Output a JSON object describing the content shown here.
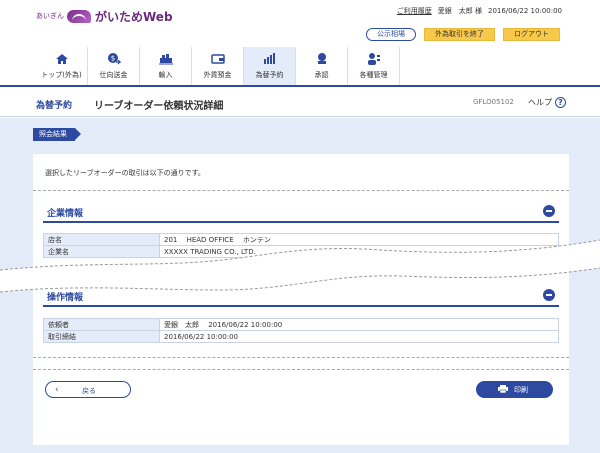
{
  "header": {
    "logo_prefix": "あいぎん",
    "logo_name": "がいためWeb",
    "history_link": "ご利用履歴",
    "user": "愛銀　太郎 様",
    "datetime": "2016/06/22 10:00:00",
    "rates_button": "公示相場",
    "end_button": "外為取引を終了",
    "logout_button": "ログアウト"
  },
  "nav": {
    "items": [
      {
        "label": "トップ(外為)",
        "icon": "home-icon"
      },
      {
        "label": "仕向送金",
        "icon": "remittance-icon"
      },
      {
        "label": "輸入",
        "icon": "import-icon"
      },
      {
        "label": "外貨預金",
        "icon": "deposit-icon"
      },
      {
        "label": "為替予約",
        "icon": "forex-contract-icon"
      },
      {
        "label": "承認",
        "icon": "approval-icon"
      },
      {
        "label": "各種管理",
        "icon": "management-icon"
      }
    ]
  },
  "titlebar": {
    "section": "為替予約",
    "title": "リーブオーダー依頼状況詳細",
    "code": "GFLO05102",
    "help": "ヘルプ"
  },
  "main": {
    "crumb": "照会結果",
    "intro": "選択したリーブオーダーの取引は以下の通りです。",
    "company_section": {
      "title": "企業情報",
      "rows": [
        {
          "label": "店名",
          "value": "201　 HEAD OFFICE　 ホンテン"
        },
        {
          "label": "企業名",
          "value": "XXXXX TRADING CO., LTD."
        }
      ]
    },
    "operation_section": {
      "title": "操作情報",
      "rows": [
        {
          "label": "依頼者",
          "value": "愛銀　太郎　 2016/06/22 10:00:00"
        },
        {
          "label": "取引締結",
          "value": "2016/06/22 10:00:00"
        }
      ]
    },
    "back_button": "戻る",
    "print_button": "印刷"
  }
}
